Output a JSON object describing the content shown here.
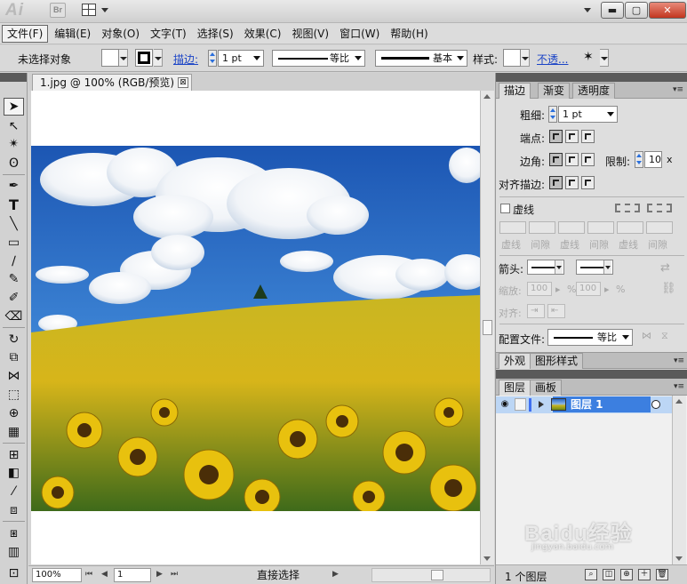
{
  "app": {
    "logo": "Ai",
    "bridge": "Br",
    "window_controls": {
      "minimize": "▬",
      "restore": "▢",
      "close": "✕"
    }
  },
  "menu": [
    "文件(F)",
    "编辑(E)",
    "对象(O)",
    "文字(T)",
    "选择(S)",
    "效果(C)",
    "视图(V)",
    "窗口(W)",
    "帮助(H)"
  ],
  "control_bar": {
    "selection_status": "未选择对象",
    "stroke_label": "描边:",
    "stroke_weight": "1 pt",
    "profile_label": "等比",
    "brush_label": "基本",
    "style_label": "样式:",
    "opacity_link": "不透..."
  },
  "document": {
    "tab_title": "1.jpg @ 100% (RGB/预览)",
    "tab_close": "⊠",
    "zoom": "100%",
    "artboard_number": "1",
    "status_text": "直接选择"
  },
  "stroke_panel": {
    "tabs": [
      "描边",
      "渐变",
      "透明度"
    ],
    "weight_label": "粗细:",
    "weight_value": "1 pt",
    "cap_label": "端点:",
    "corner_label": "边角:",
    "limit_label": "限制:",
    "limit_value": "10",
    "limit_unit": "x",
    "align_label": "对齐描边:",
    "dashed_label": "虚线",
    "dash_labels": [
      "虚线",
      "间隙",
      "虚线",
      "间隙",
      "虚线",
      "间隙"
    ],
    "arrowheads_label": "箭头:",
    "scale_label": "缩放:",
    "scale_values": [
      "100",
      "100"
    ],
    "scale_unit": "%",
    "align_arrow_label": "对齐:",
    "profile_label": "配置文件:",
    "profile_value": "等比"
  },
  "appearance_tabs": [
    "外观",
    "图形样式"
  ],
  "layers_panel": {
    "tabs": [
      "图层",
      "画板"
    ],
    "layers": [
      {
        "name": "图层 1"
      }
    ],
    "footer_count": "1 个图层"
  },
  "watermark": {
    "main": "Baidu经验",
    "sub": "jingyan.baidu.com"
  },
  "colors": {
    "layer_selected": "#3c7fe0",
    "layer_row": "#bcd6f5",
    "link": "#1b44c6",
    "close_button": "#c2361f"
  }
}
